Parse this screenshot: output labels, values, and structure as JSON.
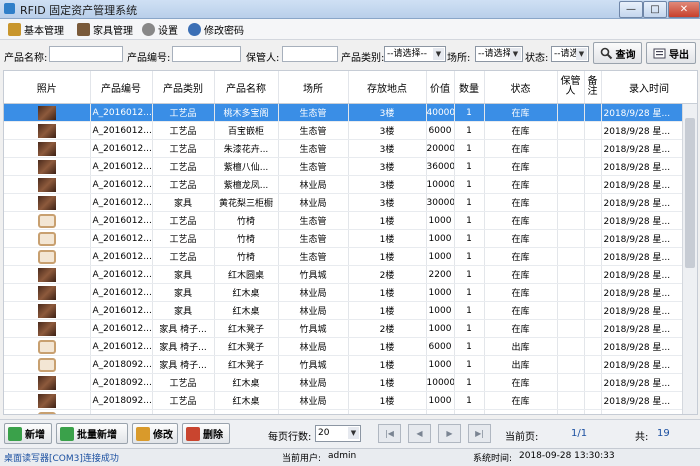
{
  "window": {
    "title": "RFID 固定资产管理系统",
    "min": "—",
    "max": "□",
    "close": "✕"
  },
  "menu": [
    {
      "label": "基本管理",
      "icon": "basic-manage-icon",
      "color": "#c8962e"
    },
    {
      "label": "家具管理",
      "icon": "furniture-manage-icon",
      "color": "#7a5a3a"
    },
    {
      "label": "设置",
      "icon": "gear-icon",
      "color": "#888888"
    },
    {
      "label": "修改密码",
      "icon": "user-key-icon",
      "color": "#3b6fb5"
    }
  ],
  "filters": {
    "name_label": "产品名称:",
    "code_label": "产品编号:",
    "keeper_label": "保管人:",
    "category_label": "产品类别:",
    "category_value": "--请选择--",
    "place_label": "场所:",
    "place_value": "--请选择",
    "status_label": "状态:",
    "status_value": "--请选",
    "search_button": "查询",
    "export_button": "导出"
  },
  "table": {
    "columns": [
      "照片",
      "产品编号",
      "产品类别",
      "产品名称",
      "场所",
      "存放地点",
      "价值",
      "数量",
      "状态",
      "保管人",
      "备注",
      "录入时间"
    ],
    "rows": [
      {
        "photo": "dark",
        "code": "A_2016012...",
        "category": "工艺品",
        "name": "桃木多宝阁",
        "place": "生态管",
        "location": "3楼",
        "value": "40000",
        "qty": "1",
        "status": "在库",
        "keeper": "",
        "note": "",
        "time": "2018/9/28 星..."
      },
      {
        "photo": "dark",
        "code": "A_2016012...",
        "category": "工艺品",
        "name": "百宝嵌柜",
        "place": "生态管",
        "location": "3楼",
        "value": "6000",
        "qty": "1",
        "status": "在库",
        "keeper": "",
        "note": "",
        "time": "2018/9/28 星..."
      },
      {
        "photo": "dark",
        "code": "A_2016012...",
        "category": "工艺品",
        "name": "朱漆花卉...",
        "place": "生态管",
        "location": "3楼",
        "value": "20000",
        "qty": "1",
        "status": "在库",
        "keeper": "",
        "note": "",
        "time": "2018/9/28 星..."
      },
      {
        "photo": "dark",
        "code": "A_2016012...",
        "category": "工艺品",
        "name": "紫檀八仙...",
        "place": "生态管",
        "location": "3楼",
        "value": "36000",
        "qty": "1",
        "status": "在库",
        "keeper": "",
        "note": "",
        "time": "2018/9/28 星..."
      },
      {
        "photo": "dark",
        "code": "A_2016012...",
        "category": "工艺品",
        "name": "紫檀龙凤...",
        "place": "林业局",
        "location": "3楼",
        "value": "10000",
        "qty": "1",
        "status": "在库",
        "keeper": "",
        "note": "",
        "time": "2018/9/28 星..."
      },
      {
        "photo": "dark",
        "code": "A_2016012...",
        "category": "家具",
        "name": "黄花梨三柜橱",
        "place": "林业局",
        "location": "3楼",
        "value": "30000",
        "qty": "1",
        "status": "在库",
        "keeper": "",
        "note": "",
        "time": "2018/9/28 星..."
      },
      {
        "photo": "chair",
        "code": "A_2016012...",
        "category": "工艺品",
        "name": "竹椅",
        "place": "生态管",
        "location": "1楼",
        "value": "1000",
        "qty": "1",
        "status": "在库",
        "keeper": "",
        "note": "",
        "time": "2018/9/28 星..."
      },
      {
        "photo": "chair",
        "code": "A_2016012...",
        "category": "工艺品",
        "name": "竹椅",
        "place": "生态管",
        "location": "1楼",
        "value": "1000",
        "qty": "1",
        "status": "在库",
        "keeper": "",
        "note": "",
        "time": "2018/9/28 星..."
      },
      {
        "photo": "chair",
        "code": "A_2016012...",
        "category": "工艺品",
        "name": "竹椅",
        "place": "生态管",
        "location": "1楼",
        "value": "1000",
        "qty": "1",
        "status": "在库",
        "keeper": "",
        "note": "",
        "time": "2018/9/28 星..."
      },
      {
        "photo": "dark",
        "code": "A_2016012...",
        "category": "家具",
        "name": "红木圆桌",
        "place": "竹具城",
        "location": "2楼",
        "value": "2200",
        "qty": "1",
        "status": "在库",
        "keeper": "",
        "note": "",
        "time": "2018/9/28 星..."
      },
      {
        "photo": "dark",
        "code": "A_2016012...",
        "category": "家具",
        "name": "红木桌",
        "place": "林业局",
        "location": "1楼",
        "value": "1000",
        "qty": "1",
        "status": "在库",
        "keeper": "",
        "note": "",
        "time": "2018/9/28 星..."
      },
      {
        "photo": "dark",
        "code": "A_2016012...",
        "category": "家具",
        "name": "红木桌",
        "place": "林业局",
        "location": "1楼",
        "value": "1000",
        "qty": "1",
        "status": "在库",
        "keeper": "",
        "note": "",
        "time": "2018/9/28 星..."
      },
      {
        "photo": "dark",
        "code": "A_2016012...",
        "category": "家具 椅子...",
        "name": "红木凳子",
        "place": "竹具城",
        "location": "2楼",
        "value": "1000",
        "qty": "1",
        "status": "在库",
        "keeper": "",
        "note": "",
        "time": "2018/9/28 星..."
      },
      {
        "photo": "chair",
        "code": "A_2016012...",
        "category": "家具 椅子...",
        "name": "红木凳子",
        "place": "林业局",
        "location": "1楼",
        "value": "6000",
        "qty": "1",
        "status": "出库",
        "keeper": "",
        "note": "",
        "time": "2018/9/28 星..."
      },
      {
        "photo": "chair",
        "code": "A_2018092...",
        "category": "家具 椅子...",
        "name": "红木凳子",
        "place": "竹具城",
        "location": "1楼",
        "value": "1000",
        "qty": "1",
        "status": "出库",
        "keeper": "",
        "note": "",
        "time": "2018/9/28 星..."
      },
      {
        "photo": "dark",
        "code": "A_2018092...",
        "category": "工艺品",
        "name": "红木桌",
        "place": "林业局",
        "location": "1楼",
        "value": "10000",
        "qty": "1",
        "status": "在库",
        "keeper": "",
        "note": "",
        "time": "2018/9/28 星..."
      },
      {
        "photo": "dark",
        "code": "A_2018092...",
        "category": "工艺品",
        "name": "红木桌",
        "place": "林业局",
        "location": "1楼",
        "value": "1000",
        "qty": "1",
        "status": "在库",
        "keeper": "",
        "note": "",
        "time": "2018/9/28 星..."
      },
      {
        "photo": "chair",
        "code": "A_2018092...",
        "category": "家具 椅子...",
        "name": "凳子",
        "place": "竹具城",
        "location": "1楼",
        "value": "1000",
        "qty": "1",
        "status": "在库",
        "keeper": "",
        "note": "",
        "time": "2018/9/28 星..."
      }
    ],
    "selected_index": 0
  },
  "bottom": {
    "add": "新增",
    "batch_add": "批量新增",
    "edit": "修改",
    "delete": "删除",
    "rows_per_page_label": "每页行数:",
    "rows_per_page_value": "20",
    "current_page_label": "当前页:",
    "current_page_value": "1/1",
    "total_label": "共:",
    "total_value": "19"
  },
  "status": {
    "reader": "桌面读写器[COM3]连接成功",
    "user_label": "当前用户:",
    "user_value": "admin",
    "time_label": "系统时间:",
    "time_value": "2018-09-28 13:30:33"
  },
  "colors": {
    "selected_row": "#3a8ee6",
    "accent_blue": "#2f7fc9"
  }
}
